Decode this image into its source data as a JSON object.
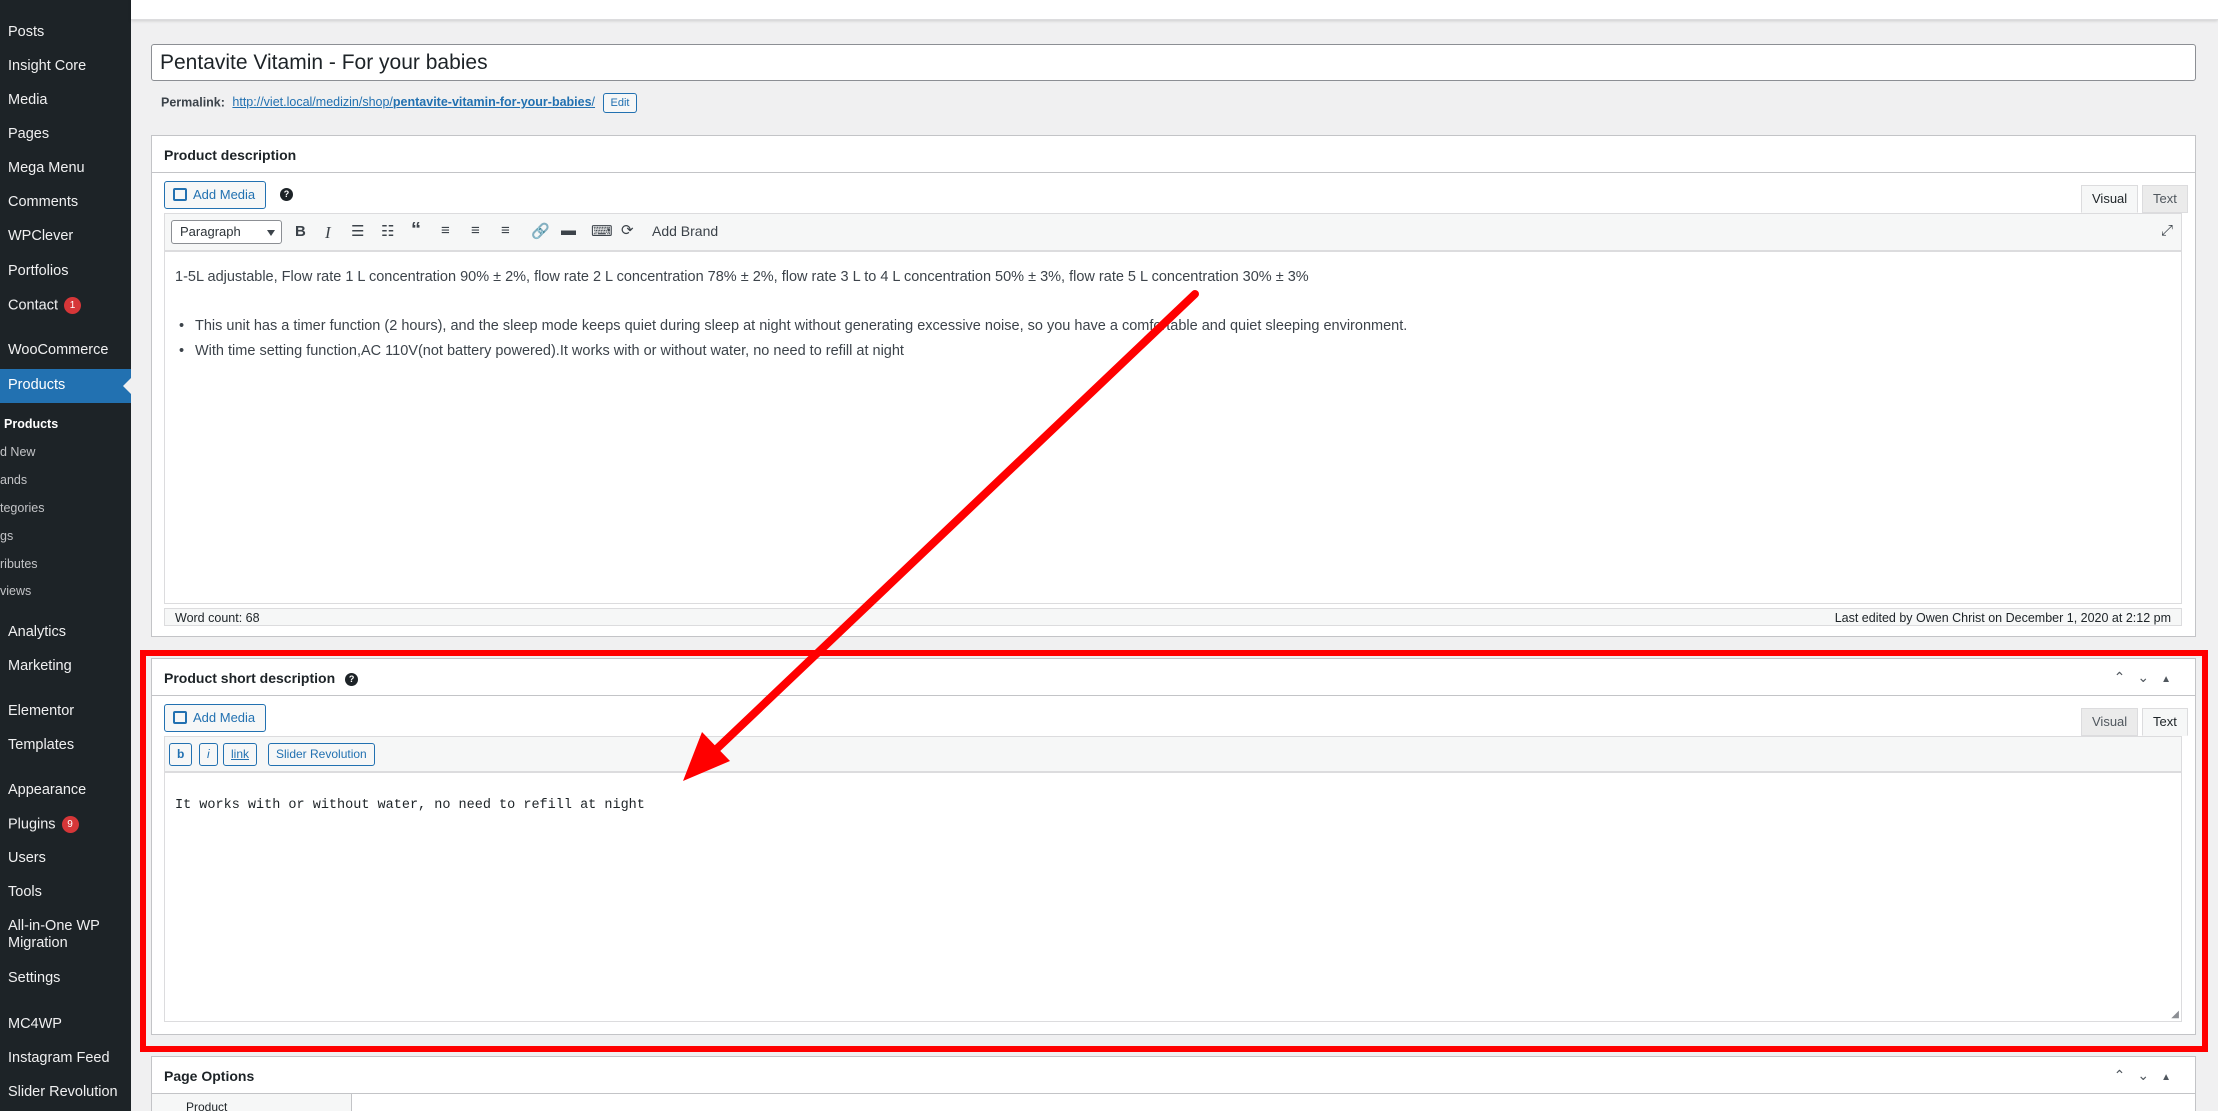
{
  "sidebar": {
    "items": [
      {
        "label": "Posts"
      },
      {
        "label": "Insight Core"
      },
      {
        "label": "Media"
      },
      {
        "label": "Pages"
      },
      {
        "label": "Mega Menu"
      },
      {
        "label": "Comments"
      },
      {
        "label": "WPClever"
      },
      {
        "label": "Portfolios"
      },
      {
        "label": "Contact",
        "badge": "1"
      },
      {
        "label": "WooCommerce"
      },
      {
        "label": "Products"
      },
      {
        "label": "Analytics"
      },
      {
        "label": "Marketing"
      },
      {
        "label": "Elementor"
      },
      {
        "label": "Templates"
      },
      {
        "label": "Appearance"
      },
      {
        "label": "Plugins",
        "badge": "9"
      },
      {
        "label": "Users"
      },
      {
        "label": "Tools"
      },
      {
        "label": "All-in-One WP",
        "label2": "Migration"
      },
      {
        "label": "Settings"
      },
      {
        "label": "MC4WP"
      },
      {
        "label": "Instagram Feed"
      },
      {
        "label": "Slider Revolution"
      }
    ],
    "products_sub": [
      "Products",
      "d New",
      "ands",
      "tegories",
      "gs",
      "ributes",
      "views"
    ]
  },
  "post": {
    "title": "Pentavite Vitamin - For your babies",
    "permalink_label": "Permalink:",
    "permalink_base": "http://viet.local/medizin/shop/",
    "permalink_slug": "pentavite-vitamin-for-your-babies",
    "permalink_tail": "/",
    "edit_label": "Edit"
  },
  "description_box": {
    "title": "Product description",
    "add_media": "Add Media",
    "help": "?",
    "tab_visual": "Visual",
    "tab_text": "Text",
    "format_selected": "Paragraph",
    "add_brand": "Add Brand",
    "content_line1": "1-5L adjustable, Flow rate 1 L concentration 90% ± 2%, flow rate 2 L concentration 78% ± 2%, flow rate 3 L to 4 L concentration 50% ± 3%, flow rate 5 L concentration 30% ± 3%",
    "bullet1": "This unit has a timer function (2 hours), and the sleep mode keeps quiet during sleep at night without generating excessive noise, so you have a comfortable and quiet sleeping environment.",
    "bullet2": "With time setting function,AC 110V(not battery powered).It works with or without water, no need to refill at night",
    "word_count": "Word count: 68",
    "last_edited": "Last edited by Owen Christ on December 1, 2020 at 2:12 pm"
  },
  "short_box": {
    "title": "Product short description",
    "help": "?",
    "add_media": "Add Media",
    "tab_visual": "Visual",
    "tab_text": "Text",
    "qt_buttons": [
      "b",
      "i",
      "link",
      "Slider Revolution"
    ],
    "content": "It works with or without water, no need to refill at night"
  },
  "page_options": {
    "title": "Page Options",
    "first_tab": "Product"
  },
  "annotation": {
    "color": "#ff0000"
  }
}
